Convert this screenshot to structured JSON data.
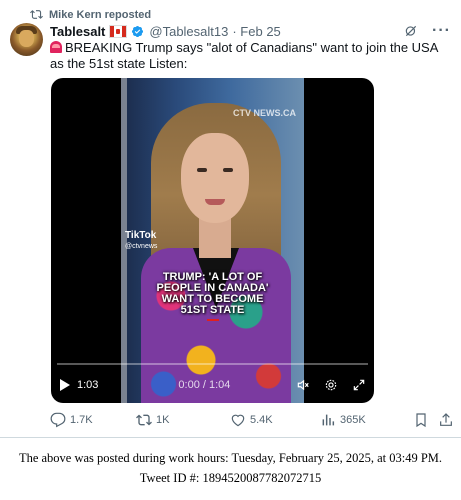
{
  "repost": {
    "text": "Mike Kern reposted"
  },
  "author": {
    "name": "Tablesalt",
    "handle": "@Tablesalt13",
    "date": "· Feb 25"
  },
  "tweet": {
    "text": "BREAKING Trump says \"alot of Canadians\" want to join the USA as the 51st state Listen:"
  },
  "video": {
    "watermark": "CTV NEWS.CA",
    "tiktok_label": "TikTok",
    "tiktok_handle": "@ctvnews",
    "caption_lines": [
      "TRUMP: 'A LOT OF",
      "PEOPLE IN CANADA'",
      "WANT TO BECOME",
      "51ST STATE"
    ],
    "remaining_time": "1:03",
    "time_display": "0:00 / 1:04",
    "progress": 0.0
  },
  "actions": {
    "replies": "1.7K",
    "reposts": "1K",
    "likes": "5.4K",
    "views": "365K"
  },
  "footer": {
    "line1": "The above was posted during work hours: Tuesday, February 25, 2025, at 03:49 PM.",
    "line2": "Tweet ID #: 1894520087782072715"
  },
  "colors": {
    "accent": "#1d9bf0",
    "secondary_text": "#536471",
    "primary_text": "#0f1419",
    "flag_red": "#d52b1e",
    "caption_red": "#e02020"
  }
}
